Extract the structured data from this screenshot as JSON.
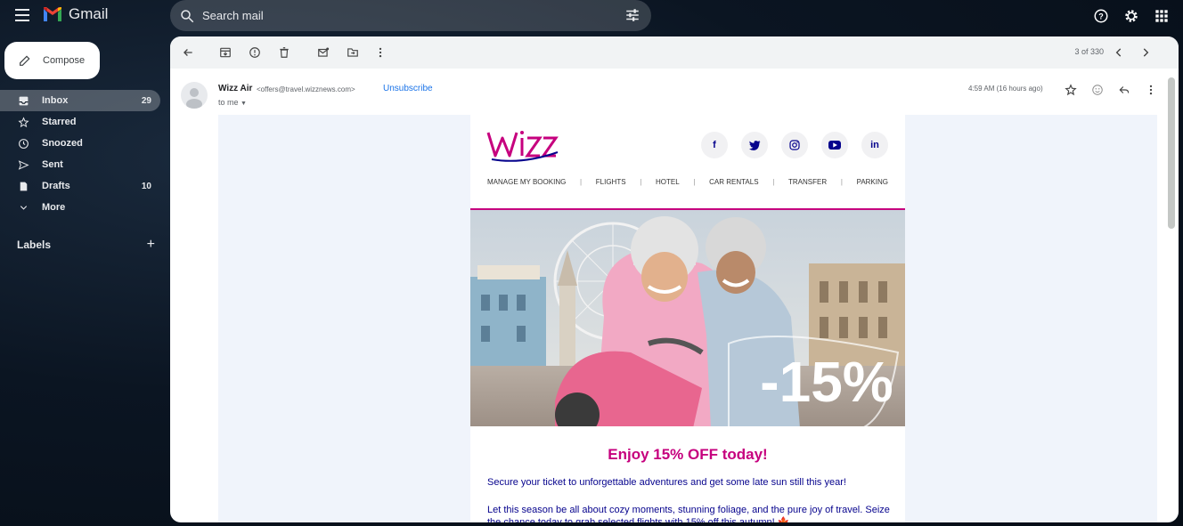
{
  "app": {
    "name": "Gmail"
  },
  "search": {
    "placeholder": "Search mail"
  },
  "compose": {
    "label": "Compose"
  },
  "nav": {
    "items": [
      {
        "label": "Inbox",
        "count": "29",
        "icon": "inbox-icon",
        "active": true
      },
      {
        "label": "Starred",
        "count": "",
        "icon": "star-icon"
      },
      {
        "label": "Snoozed",
        "count": "",
        "icon": "clock-icon"
      },
      {
        "label": "Sent",
        "count": "",
        "icon": "send-icon"
      },
      {
        "label": "Drafts",
        "count": "10",
        "icon": "draft-icon"
      },
      {
        "label": "More",
        "count": "",
        "icon": "chevron-down-icon"
      }
    ]
  },
  "labels": {
    "title": "Labels"
  },
  "toolbar": {
    "pager": "3 of 330"
  },
  "message": {
    "sender_name": "Wizz Air",
    "sender_email": "<offers@travel.wizznews.com>",
    "unsubscribe": "Unsubscribe",
    "to": "to me",
    "timestamp": "4:59 AM (16 hours ago)"
  },
  "email": {
    "menu": [
      "MANAGE MY BOOKING",
      "FLIGHTS",
      "HOTEL",
      "CAR RENTALS",
      "TRANSFER",
      "PARKING"
    ],
    "hero_badge": "-15%",
    "headline": "Enjoy 15% OFF today!",
    "para1": "Secure your ticket to unforgettable adventures and get some late sun still this year!",
    "para2": "Let this season be all about cozy moments, stunning foliage, and the pure joy of travel. Seize the chance today to grab selected flights with 15% off this autumn! 🍁"
  },
  "colors": {
    "brand_magenta": "#c6007e",
    "brand_navy": "#06038d",
    "link_blue": "#1a73e8"
  }
}
